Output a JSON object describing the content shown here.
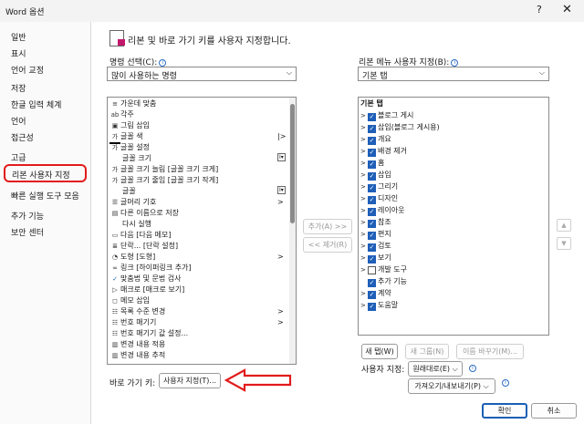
{
  "window": {
    "title": "Word 옵션",
    "help_glyph": "?",
    "close_glyph": "✕"
  },
  "sidebar": {
    "items": [
      {
        "label": "일반"
      },
      {
        "label": "표시"
      },
      {
        "label": "언어 교정"
      },
      {
        "label": "저장"
      },
      {
        "label": "한글 입력 체계"
      },
      {
        "label": "언어"
      },
      {
        "label": "접근성"
      },
      {
        "label": "고급"
      },
      {
        "label": "리본 사용자 지정",
        "selected": true
      },
      {
        "label": "빠른 실행 도구 모음"
      },
      {
        "label": "추가 기능"
      },
      {
        "label": "보안 센터"
      }
    ]
  },
  "header": {
    "text": "리본 및 바로 가기 키를 사용자 지정합니다."
  },
  "commands": {
    "label": "명령 선택(C):",
    "dropdown_value": "많이 사용하는 명령",
    "items": [
      {
        "label": "가운데 맞춤",
        "icon": "align-center-icon"
      },
      {
        "label": "각주",
        "icon": "footnote-icon"
      },
      {
        "label": "그림 삽입",
        "icon": "picture-icon"
      },
      {
        "label": "글꼴 색",
        "icon": "font-color-icon",
        "submenu": true
      },
      {
        "label": "글꼴 설정",
        "icon": "font-icon"
      },
      {
        "label": "글꼴 크기",
        "icon": "",
        "indent": true,
        "combo": true
      },
      {
        "label": "글꼴 크기 늘림 [글꼴 크기 크게]",
        "icon": "grow-font-icon"
      },
      {
        "label": "글꼴 크기 줄임 [글꼴 크기 작게]",
        "icon": "shrink-font-icon"
      },
      {
        "label": "글꼴",
        "icon": "",
        "indent": true,
        "combo": true
      },
      {
        "label": "글머리 기호",
        "icon": "bullets-icon",
        "submenu": true
      },
      {
        "label": "다른 이름으로 저장",
        "icon": "save-as-icon"
      },
      {
        "label": "다시 실행",
        "icon": "",
        "indent": true
      },
      {
        "label": "다음 [다음 메모]",
        "icon": "next-comment-icon"
      },
      {
        "label": "단락... [단락 설정]",
        "icon": "paragraph-icon"
      },
      {
        "label": "도형 [도형]",
        "icon": "shapes-icon",
        "submenu": true
      },
      {
        "label": "링크 [하이퍼링크 추가]",
        "icon": "link-icon"
      },
      {
        "label": "맞춤법 및 문법 검사",
        "icon": "spelling-icon"
      },
      {
        "label": "매크로 [매크로 보기]",
        "icon": "macro-icon"
      },
      {
        "label": "메모 삽입",
        "icon": "comment-icon"
      },
      {
        "label": "목록 수준 변경",
        "icon": "list-level-icon",
        "submenu": true
      },
      {
        "label": "번호 매기기",
        "icon": "numbering-icon",
        "submenu": true
      },
      {
        "label": "번호 매기기 값 설정...",
        "icon": "numbering-value-icon"
      },
      {
        "label": "변경 내용 적용",
        "icon": "accept-changes-icon"
      },
      {
        "label": "변경 내용 추적",
        "icon": "track-changes-icon"
      }
    ],
    "scroll": {
      "position": 0.02,
      "visible_fraction": 0.45
    }
  },
  "middle": {
    "add_label": "추가(A) >>",
    "remove_label": "<< 제거(R)"
  },
  "ribbon": {
    "label": "리본 메뉴 사용자 지정(B):",
    "dropdown_value": "기본 탭",
    "tree_header": "기본 탭",
    "items": [
      {
        "label": "블로그 게시",
        "checked": true
      },
      {
        "label": "삽입(블로그 게시용)",
        "checked": true
      },
      {
        "label": "개요",
        "checked": true
      },
      {
        "label": "배경 제거",
        "checked": true
      },
      {
        "label": "홈",
        "checked": true
      },
      {
        "label": "삽입",
        "checked": true
      },
      {
        "label": "그리기",
        "checked": true
      },
      {
        "label": "디자인",
        "checked": true
      },
      {
        "label": "레이아웃",
        "checked": true
      },
      {
        "label": "참조",
        "checked": true
      },
      {
        "label": "편지",
        "checked": true
      },
      {
        "label": "검토",
        "checked": true
      },
      {
        "label": "보기",
        "checked": true
      },
      {
        "label": "개발 도구",
        "checked": false
      },
      {
        "label": "추가 기능",
        "checked": true,
        "no_expander": true
      },
      {
        "label": "계약",
        "checked": true
      },
      {
        "label": "도움말",
        "checked": true
      }
    ],
    "new_tab_label": "새 탭(W)",
    "new_group_label": "새 그룹(N)",
    "rename_label": "이름 바꾸기(M)...",
    "customize_label": "사용자 지정:",
    "reset_label": "원래대로(E)",
    "import_export_label": "가져오기/내보내기(P)",
    "up_glyph": "▲",
    "down_glyph": "▼"
  },
  "shortcut": {
    "label": "바로 가기 키:",
    "button_label": "사용자 지정(T)..."
  },
  "footer": {
    "ok_label": "확인",
    "cancel_label": "취소"
  },
  "colors": {
    "accent": "#1f5fb8",
    "highlight": "#e21b1b"
  }
}
